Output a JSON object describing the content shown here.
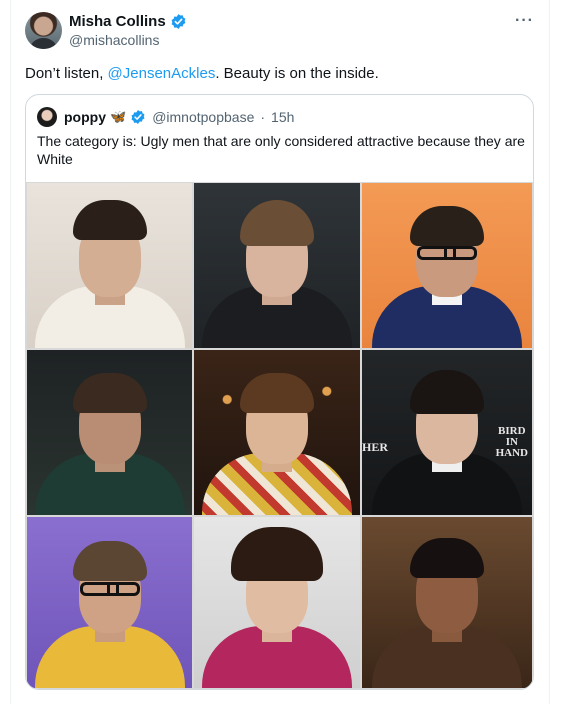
{
  "tweet": {
    "author_name": "Misha Collins",
    "author_handle": "@mishacollins",
    "more_label": "···",
    "text_before": "Don’t listen, ",
    "mention": "@JensenAckles",
    "text_after": ". Beauty is on the inside."
  },
  "quote": {
    "author_name": "poppy",
    "emoji": "🦋",
    "author_handle": "@imnotpopbase",
    "separator": "·",
    "time": "15h",
    "text": "The category is: Ugly men that are only considered attractive because they are White"
  },
  "grid_signs": {
    "her": "HER",
    "bird_in_hand": [
      "BIRD",
      "IN",
      "HAND"
    ]
  },
  "colors": {
    "accent": "#1d9bf0",
    "text": "#0f1419",
    "secondary": "#536471"
  }
}
